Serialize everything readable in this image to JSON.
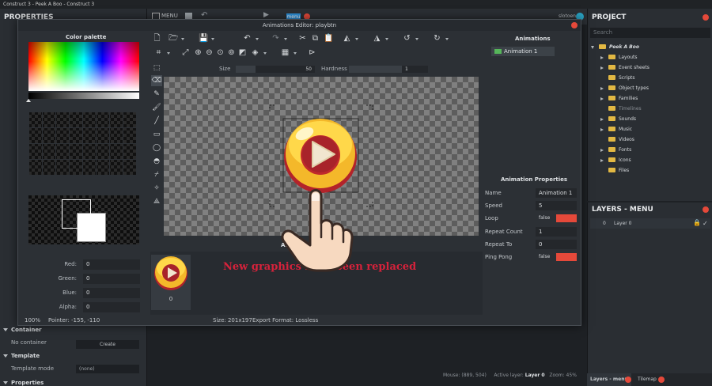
{
  "window": {
    "title": "Construct 3 - Peek A Boo - Construct 3"
  },
  "topbar": {
    "menu_label": "MENU",
    "tab_label": "menu",
    "user": "slotoen"
  },
  "properties": {
    "title": "PROPERTIES",
    "sections": {
      "container": "Container",
      "template": "Template",
      "properties": "Properties"
    },
    "container_label": "No container",
    "container_button": "Create",
    "template_label": "Template mode",
    "template_value": "(none)"
  },
  "project": {
    "title": "PROJECT",
    "search_placeholder": "Search",
    "root": "Peek A Boo",
    "folders": [
      "Layouts",
      "Event sheets",
      "Scripts",
      "Object types",
      "Families",
      "Timelines",
      "Sounds",
      "Music",
      "Videos",
      "Fonts",
      "Icons",
      "Files"
    ]
  },
  "layers": {
    "title": "LAYERS - MENU",
    "row_index": "0",
    "row_name": "Layer 0"
  },
  "bottom_tabs": {
    "layers": "Layers - menu",
    "tilemap": "Tilemap"
  },
  "statusbar": {
    "mouse": "Mouse: (889, 504)",
    "active_layer_label": "Active layer:",
    "active_layer": "Layer 0",
    "zoom": "Zoom: 45%"
  },
  "dialog": {
    "title": "Animations Editor: playbtn",
    "palette_title": "Color palette",
    "rgba": {
      "red_label": "Red:",
      "green_label": "Green:",
      "blue_label": "Blue:",
      "alpha_label": "Alpha:",
      "red": "0",
      "green": "0",
      "blue": "0",
      "alpha": "0"
    },
    "size_label": "Size",
    "size_value": "50",
    "hardness_label": "Hardness",
    "hardness_value": "1",
    "animations_title": "Animations",
    "animation_item": "Animation 1",
    "anim_props_title": "Animation Properties",
    "anim_props": {
      "name_label": "Name",
      "name": "Animation 1",
      "speed_label": "Speed",
      "speed": "5",
      "loop_label": "Loop",
      "loop": "false",
      "repeat_count_label": "Repeat Count",
      "repeat_count": "1",
      "repeat_to_label": "Repeat To",
      "repeat_to": "0",
      "ping_pong_label": "Ping Pong",
      "ping_pong": "false"
    },
    "frames_title": "Anim",
    "frame_number": "0",
    "zoom": "100%",
    "pointer": "Pointer: -155, -110",
    "size_info": "Size: 201x197",
    "export_format": "Export Format: Lossless"
  },
  "caption": "New graphics have been replaced",
  "colors": {
    "accent_red": "#e5493a",
    "button_yellow": "#f4b82a",
    "button_red": "#c0292c",
    "caption_red": "#d6223b"
  }
}
